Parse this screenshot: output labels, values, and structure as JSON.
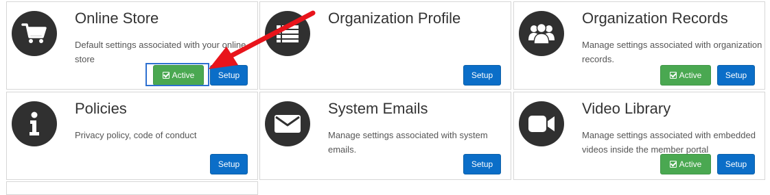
{
  "colors": {
    "setup_button": "#0b6ec8",
    "active_button": "#4aa851",
    "icon_circle": "#303030",
    "annotation_arrow": "#e8141b",
    "highlight_box": "#2d6fd0"
  },
  "cards": [
    {
      "title": "Online Store",
      "description": "Default settings associated with your online store",
      "icon": "shopping-cart-icon",
      "active_label": "Active",
      "setup_label": "Setup"
    },
    {
      "title": "Organization Profile",
      "description": "",
      "icon": "list-icon",
      "setup_label": "Setup"
    },
    {
      "title": "Organization Records",
      "description": "Manage settings associated with organization records.",
      "icon": "users-group-icon",
      "active_label": "Active",
      "setup_label": "Setup"
    },
    {
      "title": "Policies",
      "description": "Privacy policy, code of conduct",
      "icon": "info-icon",
      "setup_label": "Setup"
    },
    {
      "title": "System Emails",
      "description": "Manage settings associated with system emails.",
      "icon": "envelope-icon",
      "setup_label": "Setup"
    },
    {
      "title": "Video Library",
      "description": "Manage settings associated with embedded videos inside the member portal",
      "icon": "video-camera-icon",
      "active_label": "Active",
      "setup_label": "Setup"
    }
  ]
}
